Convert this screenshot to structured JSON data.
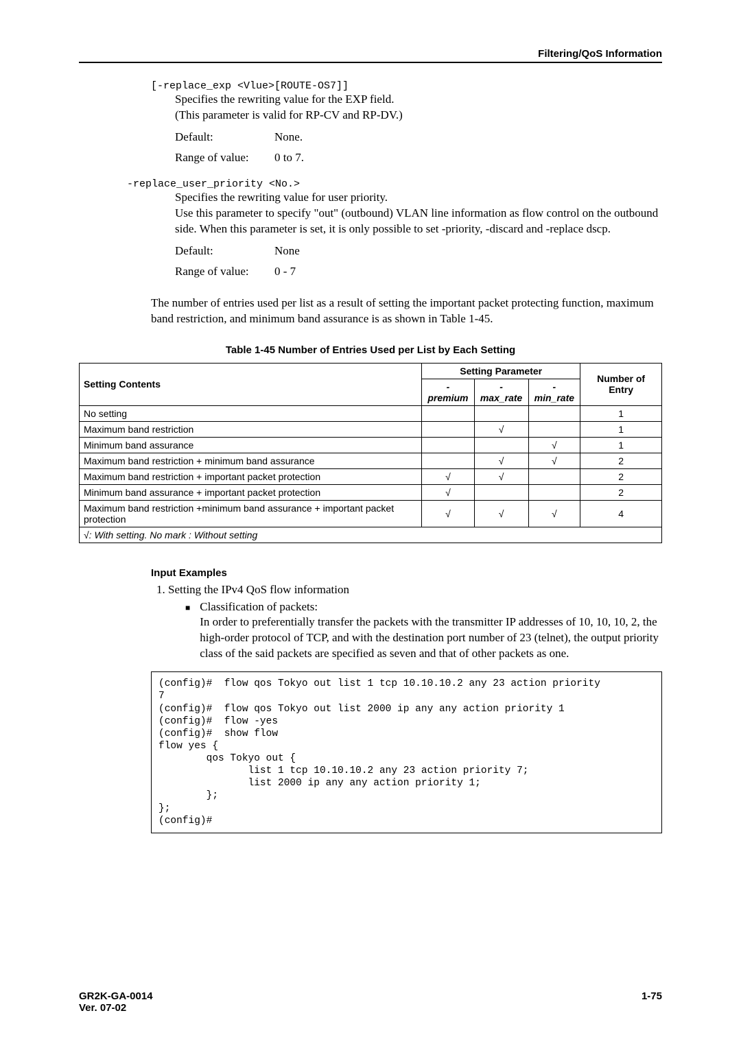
{
  "header": {
    "section": "Filtering/QoS Information"
  },
  "replace_exp": {
    "syntax": "[-replace_exp <Vlue>[ROUTE-OS7]]",
    "line1": "Specifies the rewriting value for the EXP field.",
    "line2": "(This parameter is valid for RP-CV and RP-DV.)",
    "default_label": "Default:",
    "default_value": "None.",
    "range_label": "Range of value:",
    "range_value": "0 to 7."
  },
  "replace_user_priority": {
    "syntax": "-replace_user_priority <No.>",
    "line1": "Specifies the rewriting value for user priority.",
    "line2": "Use this parameter to specify \"out\" (outbound) VLAN line information as flow control on the outbound side.  When this parameter is set, it is only possible to set -priority, -discard and -replace dscp.",
    "default_label": "Default:",
    "default_value": "None",
    "range_label": "Range of value:",
    "range_value": "0 - 7"
  },
  "intro": "The number of entries used per list as a result of setting the important packet protecting function, maximum band restriction, and minimum band assurance is as shown in Table 1-45.",
  "table": {
    "caption": "Table 1-45  Number of Entries Used per List by Each Setting",
    "headers": {
      "contents": "Setting Contents",
      "param_group": "Setting Parameter",
      "p1": "-premium",
      "p2": "-max_rate",
      "p3": "-min_rate",
      "entry": "Number of Entry"
    },
    "rows": [
      {
        "c": "No setting",
        "p1": "",
        "p2": "",
        "p3": "",
        "e": "1"
      },
      {
        "c": "Maximum band restriction",
        "p1": "",
        "p2": "√",
        "p3": "",
        "e": "1"
      },
      {
        "c": "Minimum band assurance",
        "p1": "",
        "p2": "",
        "p3": "√",
        "e": "1"
      },
      {
        "c": "Maximum band restriction + minimum band assurance",
        "p1": "",
        "p2": "√",
        "p3": "√",
        "e": "2"
      },
      {
        "c": "Maximum band restriction + important packet protection",
        "p1": "√",
        "p2": "√",
        "p3": "",
        "e": "2"
      },
      {
        "c": "Minimum band assurance + important packet protection",
        "p1": "√",
        "p2": "",
        "p3": "",
        "e": "2"
      },
      {
        "c": "Maximum band restriction +minimum band assurance + important packet protection",
        "p1": "√",
        "p2": "√",
        "p3": "√",
        "e": "4"
      }
    ],
    "legend": "√: With setting. No mark : Without setting"
  },
  "input_examples": {
    "title": "Input Examples",
    "item1": "Setting the IPv4 QoS flow information",
    "bullet_label": "Classification of packets:",
    "bullet_text": "In order to preferentially transfer the packets with the transmitter IP addresses of 10, 10, 10, 2, the high-order protocol of TCP, and with the destination port number of 23 (telnet), the output priority class of the said packets are specified as seven and that of other packets as one.",
    "code": "(config)#  flow qos Tokyo out list 1 tcp 10.10.10.2 any 23 action priority\n7\n(config)#  flow qos Tokyo out list 2000 ip any any action priority 1\n(config)#  flow -yes\n(config)#  show flow\nflow yes {\n        qos Tokyo out {\n               list 1 tcp 10.10.10.2 any 23 action priority 7;\n               list 2000 ip any any action priority 1;\n        };\n};\n(config)#"
  },
  "footer": {
    "doc": "GR2K-GA-0014",
    "ver": "Ver. 07-02",
    "page": "1-75"
  }
}
